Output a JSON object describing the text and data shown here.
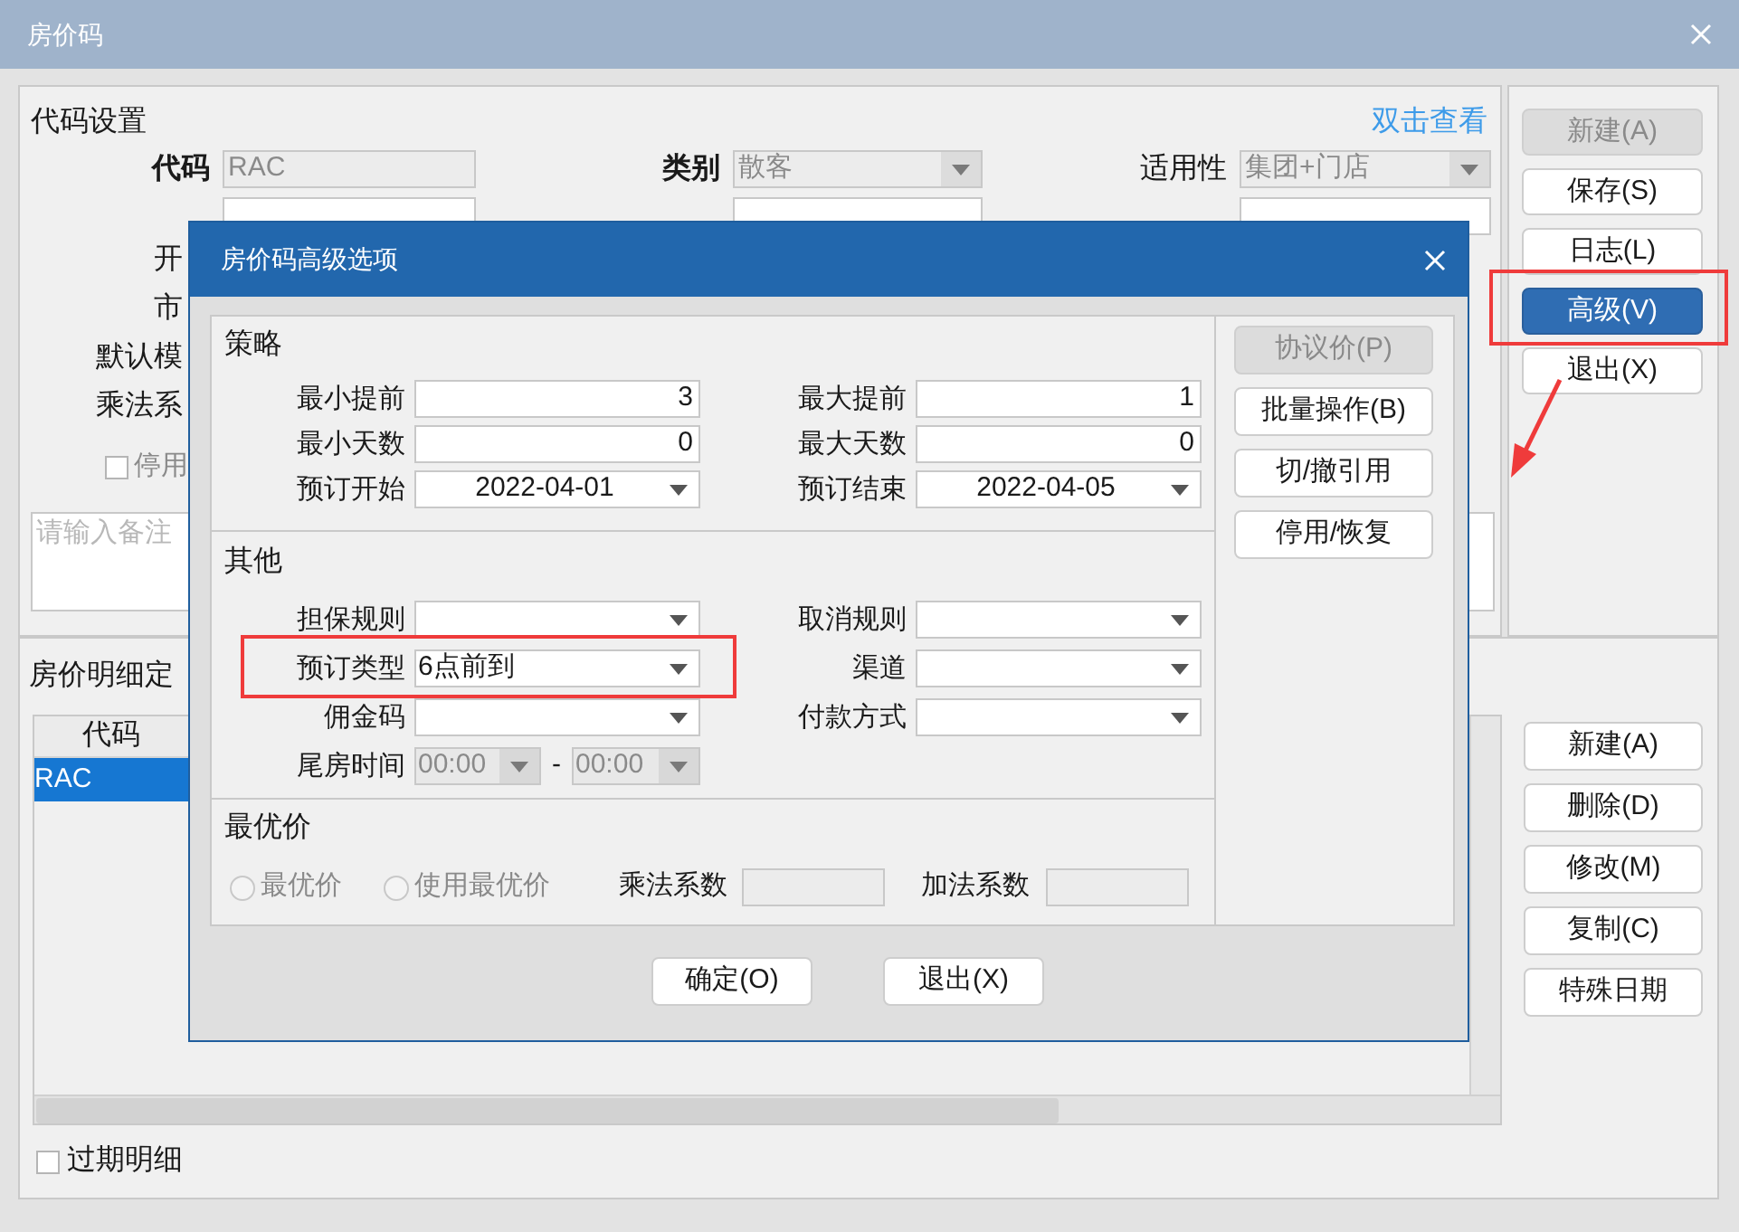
{
  "window": {
    "title": "房价码"
  },
  "code_settings": {
    "title": "代码设置",
    "link": "双击查看",
    "fields": [
      {
        "label": "代码",
        "value": "RAC",
        "kind": "text",
        "bold": true,
        "disabled": true
      },
      {
        "label": "类别",
        "value": "散客",
        "kind": "dropdown",
        "bold": true,
        "disabled": true
      },
      {
        "label": "适用性",
        "value": "集团+门店",
        "kind": "dropdown",
        "bold": false,
        "disabled": true
      }
    ],
    "cut_labels": [
      "开",
      "市",
      "默认模",
      "乘法系"
    ],
    "stop_checkbox": {
      "label": "停用",
      "checked": false
    },
    "remarks": {
      "placeholder": "请输入备注"
    }
  },
  "side_buttons": [
    {
      "label": "新建(A)",
      "disabled": true,
      "selected": false
    },
    {
      "label": "保存(S)",
      "disabled": false,
      "selected": false
    },
    {
      "label": "日志(L)",
      "disabled": false,
      "selected": false
    },
    {
      "label": "高级(V)",
      "disabled": false,
      "selected": true
    },
    {
      "label": "退出(X)",
      "disabled": false,
      "selected": false
    }
  ],
  "detail": {
    "title": "房价明细定",
    "table": {
      "columns": [
        "代码"
      ],
      "rows": [
        {
          "cells": [
            "RAC"
          ],
          "selected": true
        }
      ]
    },
    "expired_checkbox": {
      "label": "过期明细",
      "checked": false
    },
    "buttons": [
      "新建(A)",
      "删除(D)",
      "修改(M)",
      "复制(C)",
      "特殊日期"
    ]
  },
  "dialog": {
    "title": "房价码高级选项",
    "sections": [
      {
        "title": "策略",
        "rows": [
          [
            {
              "label": "最小提前",
              "value": "3",
              "kind": "number"
            },
            {
              "label": "最大提前",
              "value": "1",
              "kind": "number"
            }
          ],
          [
            {
              "label": "最小天数",
              "value": "0",
              "kind": "number"
            },
            {
              "label": "最大天数",
              "value": "0",
              "kind": "number"
            }
          ],
          [
            {
              "label": "预订开始",
              "value": "2022-04-01",
              "kind": "date"
            },
            {
              "label": "预订结束",
              "value": "2022-04-05",
              "kind": "date"
            }
          ]
        ]
      },
      {
        "title": "其他",
        "rows": [
          [
            {
              "label": "担保规则",
              "kind": "select"
            },
            {
              "label": "取消规则",
              "kind": "select"
            }
          ],
          [
            {
              "label": "预订类型",
              "value": "6点前到",
              "kind": "select"
            },
            {
              "label": "渠道",
              "kind": "select"
            }
          ],
          [
            {
              "label": "佣金码",
              "kind": "select"
            },
            {
              "label": "付款方式",
              "kind": "select"
            }
          ],
          [
            {
              "label": "尾房时间",
              "kind": "time_range",
              "values": [
                "00:00",
                "00:00"
              ],
              "separator": "-",
              "disabled": true
            }
          ]
        ]
      }
    ],
    "best_price": {
      "title": "最优价",
      "options": [
        {
          "label": "最优价",
          "selected": false,
          "disabled": true
        },
        {
          "label": "使用最优价",
          "selected": false,
          "disabled": true
        }
      ],
      "factors": [
        {
          "label": "乘法系数"
        },
        {
          "label": "加法系数"
        }
      ]
    },
    "side_buttons": [
      {
        "label": "协议价(P)",
        "disabled": true
      },
      {
        "label": "批量操作(B)",
        "disabled": false
      },
      {
        "label": "切/撤引用",
        "disabled": false
      },
      {
        "label": "停用/恢复",
        "disabled": false
      }
    ],
    "buttons": [
      "确定(O)",
      "退出(X)"
    ]
  }
}
